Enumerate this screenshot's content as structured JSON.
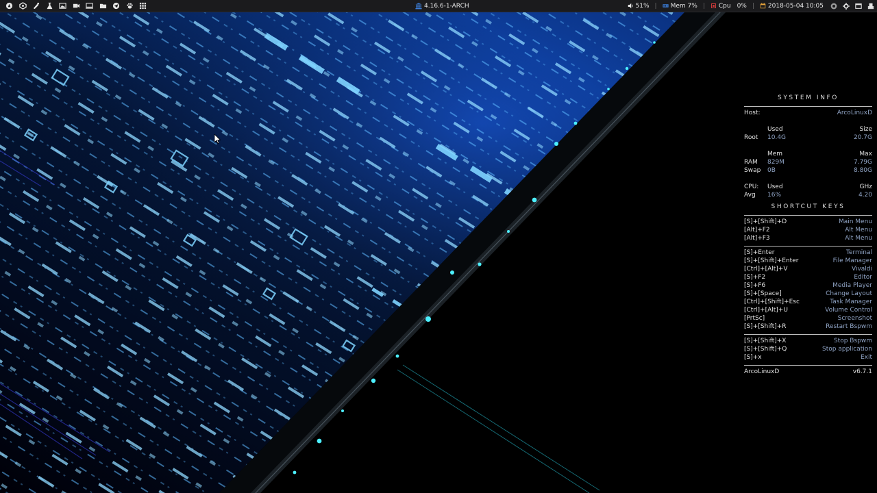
{
  "top_panel": {
    "launchers": [
      {
        "name": "start-menu-icon"
      },
      {
        "name": "arcolinux-icon"
      },
      {
        "name": "vivaldi-icon"
      },
      {
        "name": "pipette-icon"
      },
      {
        "name": "image-viewer-icon"
      },
      {
        "name": "video-camera-icon"
      },
      {
        "name": "screen-icon"
      },
      {
        "name": "folder-icon"
      },
      {
        "name": "telegram-icon"
      },
      {
        "name": "paw-icon"
      },
      {
        "name": "app-grid-icon"
      }
    ],
    "kernel": "4.16.6-1-ARCH",
    "volume": "51%",
    "mem": "Mem 7%",
    "cpu_label": "Cpu",
    "cpu_value": "0%",
    "datetime": "2018-05-04 10:05",
    "separator": "|",
    "colors": {
      "mem_icon": "#3b7dd8",
      "cpu_icon": "#d03b3b",
      "calendar_icon": "#e8a53a",
      "kernel_icon": "#3b7dd8"
    }
  },
  "conky": {
    "system_info_title": "SYSTEM INFO",
    "host_label": "Host:",
    "host_value": "ArcoLinuxD",
    "disk": {
      "used_header": "Used",
      "size_header": "Size",
      "label": "Root",
      "used": "10.4G",
      "size": "20.7G"
    },
    "memory": {
      "mem_header": "Mem",
      "max_header": "Max",
      "ram_label": "RAM",
      "ram_used": "829M",
      "ram_max": "7.79G",
      "swap_label": "Swap",
      "swap_used": "0B",
      "swap_max": "8.80G"
    },
    "cpu": {
      "label": "CPU:",
      "used_header": "Used",
      "ghz_header": "GHz",
      "avg_label": "Avg",
      "avg_used": "16%",
      "ghz": "4.20"
    },
    "shortcut_title": "SHORTCUT KEYS",
    "shortcut_groups": [
      [
        {
          "key": "[S]+[Shift]+D",
          "action": "Main Menu"
        },
        {
          "key": "[Alt]+F2",
          "action": "Alt Menu"
        },
        {
          "key": "[Alt]+F3",
          "action": "Alt Menu"
        }
      ],
      [
        {
          "key": "[S]+Enter",
          "action": "Terminal"
        },
        {
          "key": "[S]+[Shift]+Enter",
          "action": "File Manager"
        },
        {
          "key": "[Ctrl]+[Alt]+V",
          "action": "Vivaldi"
        },
        {
          "key": "[S]+F2",
          "action": "Editor"
        },
        {
          "key": "[S]+F6",
          "action": "Media Player"
        },
        {
          "key": "[S]+[Space]",
          "action": "Change Layout"
        },
        {
          "key": "[Ctrl]+[Shift]+Esc",
          "action": "Task Manager"
        },
        {
          "key": "[Ctrl]+[Alt]+U",
          "action": "Volume Control"
        },
        {
          "key": "[PrtSc]",
          "action": "Screenshot"
        },
        {
          "key": "[S]+[Shift]+R",
          "action": "Restart Bspwm"
        }
      ],
      [
        {
          "key": "[S]+[Shift]+X",
          "action": "Stop Bspwm"
        },
        {
          "key": "[S]+[Shift]+Q",
          "action": "Stop application"
        },
        {
          "key": "[S]+x",
          "action": "Exit"
        }
      ]
    ],
    "footer_left": "ArcoLinuxD",
    "footer_right": "v6.7.1"
  }
}
